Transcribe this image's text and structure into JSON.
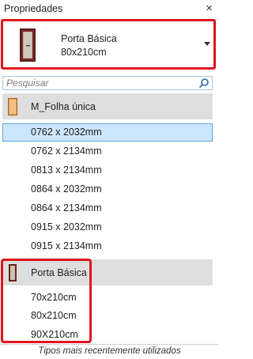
{
  "panel": {
    "title": "Propriedades",
    "close_glyph": "×"
  },
  "type_selector": {
    "family": "Porta Básica",
    "type": "80x210cm",
    "thumbnail_icon": "door-thumbnail-icon"
  },
  "search": {
    "placeholder": "Pesquisar",
    "icon": "search-icon"
  },
  "groups": [
    {
      "label": "M_Folha única",
      "icon": "door-leaf-icon",
      "items": [
        {
          "label": "0762 x 2032mm",
          "selected": true
        },
        {
          "label": "0762 x 2134mm"
        },
        {
          "label": "0813 x 2134mm"
        },
        {
          "label": "0864 x 2032mm"
        },
        {
          "label": "0864 x 2134mm"
        },
        {
          "label": "0915 x 2032mm"
        },
        {
          "label": "0915 x 2134mm"
        }
      ]
    },
    {
      "label": "Porta Básica",
      "icon": "door-frame-icon",
      "items": [
        {
          "label": "70x210cm"
        },
        {
          "label": "80x210cm"
        },
        {
          "label": "90X210cm"
        }
      ]
    }
  ],
  "footer": {
    "label": "Tipos mais recentemente utilizados"
  },
  "colors": {
    "highlight_red": "#e0141e",
    "selection_blue": "#cce6fb",
    "selection_border": "#57a6e6",
    "group_header_gray": "#dedede"
  }
}
